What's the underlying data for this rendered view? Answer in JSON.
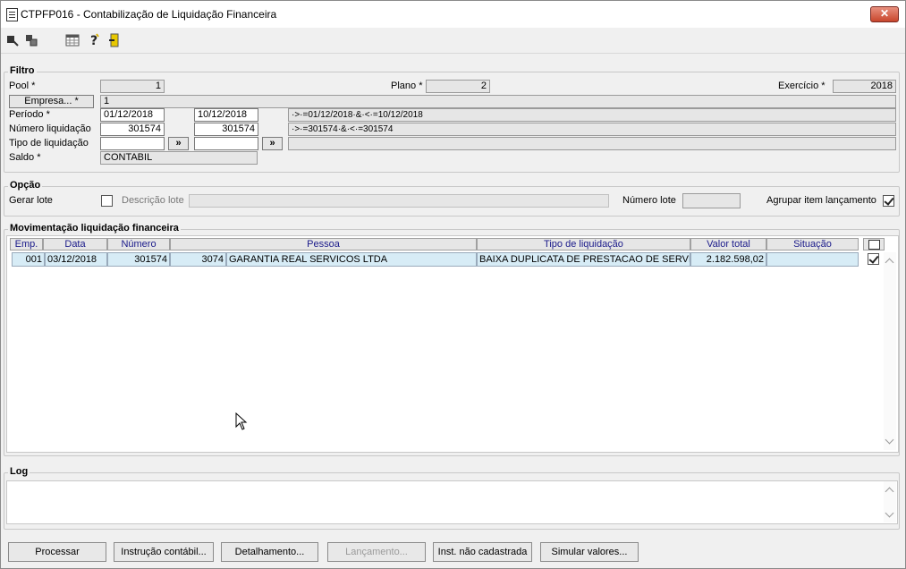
{
  "window": {
    "title": "CTPFP016 - Contabilização de Liquidação Financeira",
    "close_label": "✕"
  },
  "toolbar": {
    "icons": [
      "import-icon",
      "copy-icon",
      "calendar-grid-icon",
      "help-icon",
      "exit-door-icon"
    ]
  },
  "filtro": {
    "title": "Filtro",
    "pool_label": "Pool *",
    "pool_value": "1",
    "plano_label": "Plano *",
    "plano_value": "2",
    "exercicio_label": "Exercício *",
    "exercicio_value": "2018",
    "empresa_button": "Empresa... *",
    "empresa_value": "1",
    "periodo_label": "Período *",
    "periodo_from": "01/12/2018",
    "periodo_to": "10/12/2018",
    "periodo_expr": "·>·=01/12/2018·&·<·=10/12/2018",
    "numero_label": "Número liquidação",
    "numero_from": "301574",
    "numero_to": "301574",
    "numero_expr": "·>·=301574·&·<·=301574",
    "tipo_label": "Tipo de liquidação",
    "tipo_from": "",
    "tipo_to": "",
    "tipo_expr": "",
    "more_button": "»",
    "saldo_label": "Saldo *",
    "saldo_value": "CONTABIL"
  },
  "opcao": {
    "title": "Opção",
    "gerar_lote_label": "Gerar lote",
    "gerar_lote_checked": false,
    "descricao_label": "Descrição lote",
    "descricao_value": "",
    "numero_lote_label": "Número lote",
    "numero_lote_value": "",
    "agrupar_label": "Agrupar item lançamento",
    "agrupar_checked": true
  },
  "movimentacao": {
    "title": "Movimentação liquidação financeira",
    "columns": [
      "Emp.",
      "Data",
      "Número",
      "Pessoa",
      "Tipo de liquidação",
      "Valor total",
      "Situação"
    ],
    "rows": [
      {
        "emp": "001",
        "data": "03/12/2018",
        "numero": "301574",
        "pessoa_cod": "3074",
        "pessoa": "GARANTIA REAL SERVICOS LTDA",
        "tipo": "BAIXA DUPLICATA DE PRESTACAO DE SERVICO",
        "valor": "2.182.598,02",
        "situacao": "",
        "selected": true
      }
    ]
  },
  "log": {
    "title": "Log",
    "content": ""
  },
  "buttons": {
    "processar": "Processar",
    "instrucao": "Instrução contábil...",
    "detalhamento": "Detalhamento...",
    "lancamento": "Lançamento...",
    "inst_nao_cadastrada": "Inst. não cadastrada",
    "simular": "Simular valores..."
  }
}
